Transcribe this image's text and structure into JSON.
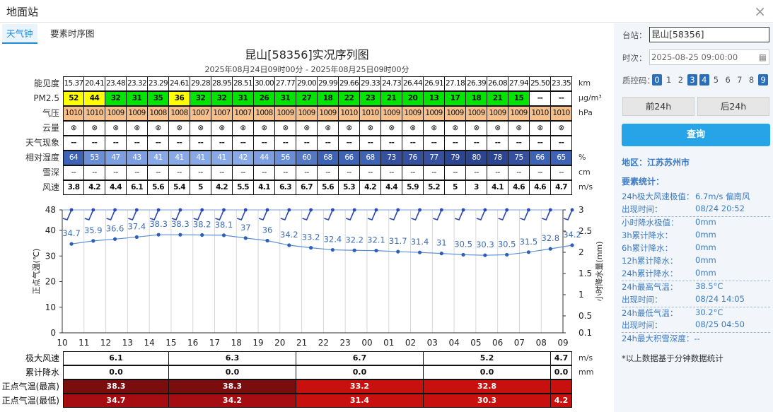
{
  "window": {
    "title": "地面站",
    "close": "×"
  },
  "tabs": [
    "天气钟",
    "要素时序图"
  ],
  "chart": {
    "title": "昆山[58356]实况序列图",
    "subtitle": "2025年08月24日09时00分 - 2025年08月25日09时00分"
  },
  "rows": [
    {
      "label": "能见度",
      "unit": "km",
      "bold": false,
      "values": [
        "15.37",
        "20.41",
        "23.48",
        "23.32",
        "23.29",
        "24.61",
        "29.28",
        "28.95",
        "28.51",
        "30.00",
        "27.77",
        "29.00",
        "29.99",
        "29.66",
        "29.33",
        "24.73",
        "26.44",
        "26.91",
        "27.18",
        "26.39",
        "26.08",
        "27.94",
        "25.50",
        "23.35"
      ],
      "colors": []
    },
    {
      "label": "PM2.5",
      "unit": "μg/m³",
      "bold": true,
      "values": [
        "52",
        "44",
        "32",
        "31",
        "35",
        "36",
        "32",
        "32",
        "31",
        "26",
        "31",
        "27",
        "18",
        "22",
        "23",
        "21",
        "20",
        "13",
        "17",
        "18",
        "21",
        "15",
        "--",
        "--"
      ],
      "colors": [
        "#ffff00",
        "#ffff00",
        "#00e400",
        "#00e400",
        "#00e400",
        "#ffff00",
        "#00e400",
        "#00e400",
        "#00e400",
        "#00e400",
        "#00e400",
        "#00e400",
        "#00e400",
        "#00e400",
        "#00e400",
        "#00e400",
        "#00e400",
        "#00e400",
        "#00e400",
        "#00e400",
        "#00e400",
        "#00e400",
        "#ffffff",
        "#ffffff"
      ]
    },
    {
      "label": "气压",
      "unit": "hPa",
      "bold": false,
      "values": [
        "1010",
        "1010",
        "1009",
        "1009",
        "1008",
        "1008",
        "1007",
        "1007",
        "1007",
        "1008",
        "1009",
        "1009",
        "1009",
        "1010",
        "1010",
        "1009",
        "1009",
        "1009",
        "1009",
        "1009",
        "1009",
        "1009",
        "1010",
        "1010"
      ],
      "colors": [
        "#f7c08a"
      ]
    },
    {
      "label": "云量",
      "unit": "",
      "bold": false,
      "values": [
        "⊗",
        "⊗",
        "⊗",
        "⊗",
        "⊗",
        "⊗",
        "⊗",
        "⊗",
        "⊗",
        "⊗",
        "⊗",
        "⊗",
        "⊗",
        "⊗",
        "⊗",
        "⊗",
        "⊗",
        "⊗",
        "⊗",
        "⊗",
        "⊗",
        "⊗",
        "⊗",
        "⊗"
      ],
      "colors": []
    },
    {
      "label": "天气现象",
      "unit": "",
      "bold": true,
      "values": [
        "--",
        "--",
        "--",
        "--",
        "--",
        "--",
        "--",
        "--",
        "--",
        "--",
        "--",
        "--",
        "--",
        "--",
        "--",
        "--",
        "--",
        "--",
        "--",
        "--",
        "--",
        "--",
        "--",
        "--"
      ],
      "colors": []
    },
    {
      "label": "相对湿度",
      "unit": "%",
      "bold": false,
      "light": true,
      "values": [
        "64",
        "53",
        "47",
        "43",
        "41",
        "41",
        "41",
        "41",
        "42",
        "44",
        "56",
        "60",
        "68",
        "66",
        "68",
        "73",
        "76",
        "77",
        "79",
        "80",
        "78",
        "75",
        "66",
        "65"
      ],
      "colors": [
        "#3e63b4",
        "#6a8fd6",
        "#7d9ee0",
        "#7d9ee0",
        "#89a8e6",
        "#89a8e6",
        "#89a8e6",
        "#89a8e6",
        "#89a8e6",
        "#7d9ee0",
        "#6a8fd6",
        "#5578c4",
        "#3e63b4",
        "#3e63b4",
        "#3e63b4",
        "#35509f",
        "#35509f",
        "#35509f",
        "#2b4590",
        "#2b4590",
        "#2b4590",
        "#35509f",
        "#3e63b4",
        "#3e63b4"
      ]
    },
    {
      "label": "雪深",
      "unit": "cm",
      "bold": false,
      "values": [
        "--",
        "--",
        "--",
        "--",
        "--",
        "--",
        "--",
        "--",
        "--",
        "--",
        "--",
        "--",
        "--",
        "--",
        "--",
        "--",
        "--",
        "--",
        "--",
        "--",
        "--",
        "--",
        "--",
        "--"
      ],
      "colors": []
    },
    {
      "label": "风速",
      "unit": "m/s",
      "bold": true,
      "values": [
        "3.8",
        "4.2",
        "4.4",
        "6.1",
        "5.6",
        "5.4",
        "5",
        "4.2",
        "5.5",
        "4.1",
        "6.3",
        "6.7",
        "5.6",
        "5.3",
        "4.2",
        "4.4",
        "5.9",
        "5.2",
        "5",
        "3",
        "4.1",
        "4.6",
        "4.6",
        "4.7"
      ],
      "colors": []
    }
  ],
  "chart_data": {
    "type": "line",
    "x": [
      "10",
      "11",
      "12",
      "13",
      "14",
      "15",
      "16",
      "17",
      "18",
      "19",
      "20",
      "21",
      "22",
      "23",
      "00",
      "01",
      "02",
      "03",
      "04",
      "05",
      "06",
      "07",
      "08",
      "09"
    ],
    "series": [
      {
        "values": [
          34.7,
          35.9,
          36.6,
          37.4,
          38.3,
          38.3,
          38.2,
          38.1,
          37,
          36,
          34.2,
          33.2,
          32.4,
          32.2,
          32.1,
          31.7,
          31.4,
          31,
          30.5,
          30.3,
          30.5,
          31.5,
          32.8,
          34.2
        ]
      }
    ],
    "precip_values": [],
    "ylabel": "正点气温(℃)",
    "y2label": "小时降水量(mm)",
    "ylim": [
      0,
      48
    ],
    "y_ticks": [
      "0",
      "10",
      "20",
      "30",
      "40",
      "48"
    ],
    "y2lim": [
      0.1,
      3
    ],
    "y2_ticks": [
      "0.1",
      "0.5",
      "1",
      "1.5",
      "2",
      "2.5",
      "3"
    ],
    "wind_barbs": true
  },
  "bottom": {
    "rows": [
      {
        "label": "极大风速",
        "unit": "m/s",
        "segments": [
          {
            "span": 5,
            "value": "6.1"
          },
          {
            "span": 6,
            "value": "6.3"
          },
          {
            "span": 6,
            "value": "6.7"
          },
          {
            "span": 6,
            "value": "5.2"
          },
          {
            "span": 1,
            "value": "4.7"
          }
        ]
      },
      {
        "label": "累计降水",
        "unit": "mm",
        "segments": [
          {
            "span": 5,
            "value": "0.0"
          },
          {
            "span": 6,
            "value": "0.0"
          },
          {
            "span": 6,
            "value": "0.0"
          },
          {
            "span": 6,
            "value": "0.0"
          },
          {
            "span": 1,
            "value": "0.0"
          }
        ]
      },
      {
        "label": "正点气温(最高)",
        "unit": "",
        "segments": [
          {
            "span": 5,
            "value": "38.3",
            "color": "#7a0d0d"
          },
          {
            "span": 6,
            "value": "38.3",
            "color": "#7a0d0d"
          },
          {
            "span": 6,
            "value": "33.2",
            "color": "#c8110f"
          },
          {
            "span": 6,
            "value": "32.8",
            "color": "#c8110f"
          },
          {
            "span": 1,
            "value": "",
            "color": "#c8110f"
          }
        ]
      },
      {
        "label": "正点气温(最低)",
        "unit": "",
        "segments": [
          {
            "span": 5,
            "value": "34.7",
            "color": "#a50d12"
          },
          {
            "span": 6,
            "value": "34.2",
            "color": "#a50d12"
          },
          {
            "span": 6,
            "value": "31.4",
            "color": "#c8110f"
          },
          {
            "span": 6,
            "value": "30.3",
            "color": "#c8110f"
          },
          {
            "span": 1,
            "value": "4.2",
            "color": "#c8110f"
          }
        ]
      }
    ]
  },
  "panel": {
    "station_label": "台站：",
    "station_value": "昆山[58356]",
    "time_label": "时次：",
    "time_value": "2025-08-25 09:00:00",
    "qc_label": "质控码：",
    "qc_codes": [
      "0",
      "1",
      "2",
      "3",
      "4",
      "5",
      "6",
      "7",
      "8",
      "9"
    ],
    "qc_active": [
      "0",
      "3",
      "4",
      "9"
    ],
    "prev_button": "前24h",
    "next_button": "后24h",
    "query_button": "查询",
    "region": "地区：江苏苏州市",
    "stats_title": "要素统计：",
    "stats": [
      {
        "label": "24h极大风速极值：",
        "value": "6.7m/s 偏南风",
        "sep": false
      },
      {
        "label": "出现时间：",
        "value": "08/24 20:52",
        "sep": false
      },
      {
        "label": "小时降水极值：",
        "value": "0mm",
        "sep": true
      },
      {
        "label": "3h累计降水：",
        "value": "0mm",
        "sep": false
      },
      {
        "label": "6h累计降水：",
        "value": "0mm",
        "sep": false
      },
      {
        "label": "12h累计降水：",
        "value": "0mm",
        "sep": false
      },
      {
        "label": "24h累计降水：",
        "value": "0mm",
        "sep": false
      },
      {
        "label": "24h最高气温：",
        "value": "38.5°C",
        "sep": true
      },
      {
        "label": "出现时间：",
        "value": "08/24 14:05",
        "sep": false
      },
      {
        "label": "24h最低气温：",
        "value": "30.2°C",
        "sep": true
      },
      {
        "label": "出现时间：",
        "value": "08/25 04:50",
        "sep": false
      },
      {
        "label": "24h最大积雪深度：--",
        "value": "",
        "sep": true
      }
    ],
    "note": "*以上数据基于分钟数据统计"
  }
}
